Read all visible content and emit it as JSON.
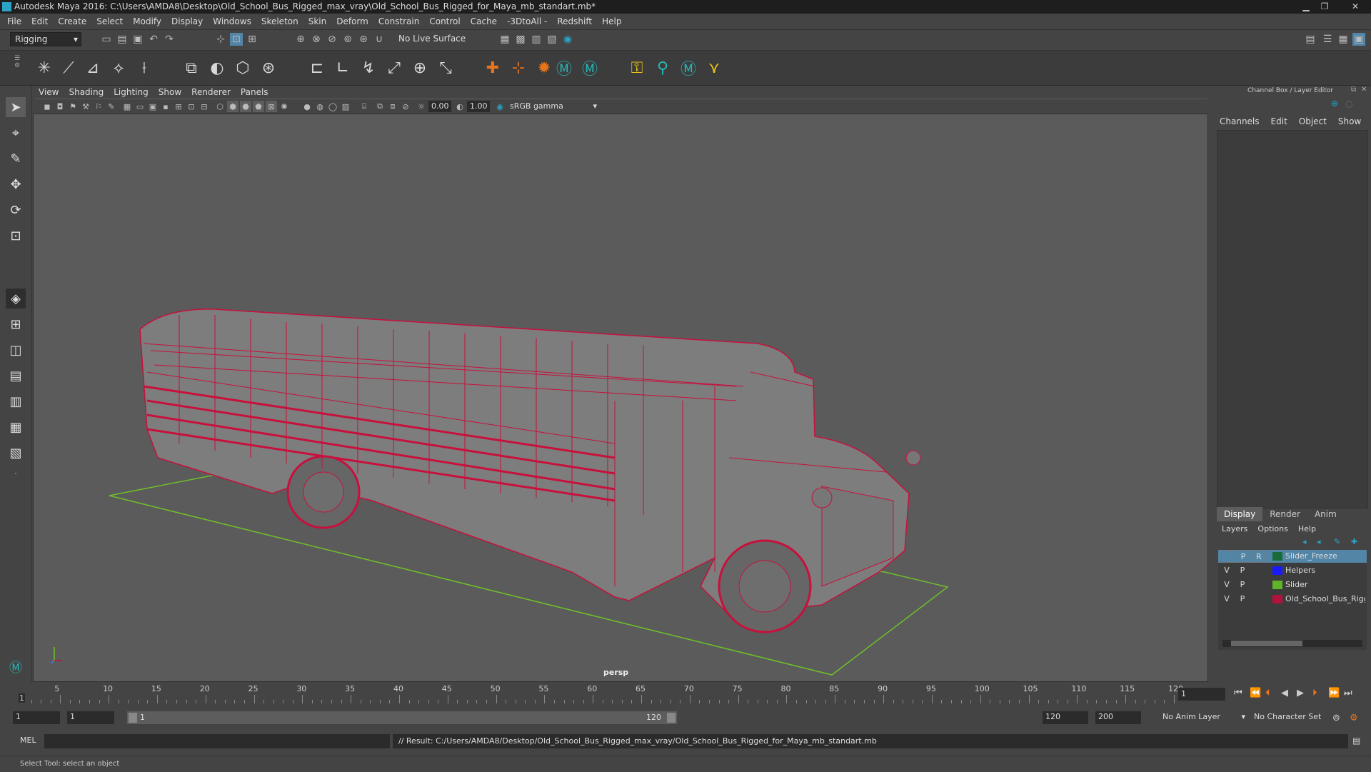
{
  "window": {
    "title": "Autodesk Maya 2016: C:\\Users\\AMDA8\\Desktop\\Old_School_Bus_Rigged_max_vray\\Old_School_Bus_Rigged_for_Maya_mb_standart.mb*",
    "min": "▁",
    "max": "❐",
    "close": "✕"
  },
  "menu": [
    "File",
    "Edit",
    "Create",
    "Select",
    "Modify",
    "Display",
    "Windows",
    "Skeleton",
    "Skin",
    "Deform",
    "Constrain",
    "Control",
    "Cache",
    "-3DtoAll -",
    "Redshift",
    "Help"
  ],
  "statusline": {
    "menuset": "Rigging",
    "live_surface": "No Live Surface"
  },
  "panel": {
    "menu": [
      "View",
      "Shading",
      "Lighting",
      "Show",
      "Renderer",
      "Panels"
    ],
    "near_value": "0.00",
    "far_value": "1.00",
    "color_space": "sRGB gamma",
    "camera_label": "persp"
  },
  "channelbox": {
    "title": "Channel Box / Layer Editor",
    "menu": [
      "Channels",
      "Edit",
      "Object",
      "Show"
    ]
  },
  "layers": {
    "tabs": [
      "Display",
      "Render",
      "Anim"
    ],
    "active_tab": "Display",
    "menu": [
      "Layers",
      "Options",
      "Help"
    ],
    "rows": [
      {
        "v": "",
        "p": "P",
        "r": "R",
        "color": "#1a6b3a",
        "name": "Slider_Freeze",
        "selected": true
      },
      {
        "v": "V",
        "p": "P",
        "r": "",
        "color": "#1a1aff",
        "name": "Helpers",
        "selected": false
      },
      {
        "v": "V",
        "p": "P",
        "r": "",
        "color": "#5fb52a",
        "name": "Slider",
        "selected": false
      },
      {
        "v": "V",
        "p": "P",
        "r": "",
        "color": "#b3123c",
        "name": "Old_School_Bus_Rigged",
        "selected": false
      }
    ]
  },
  "timeline": {
    "labels": [
      "5",
      "10",
      "15",
      "20",
      "25",
      "30",
      "35",
      "40",
      "45",
      "50",
      "55",
      "60",
      "65",
      "70",
      "75",
      "80",
      "85",
      "90",
      "95",
      "100",
      "105",
      "110",
      "115",
      "120"
    ],
    "current_frame_marker": "1",
    "current_frame": "1"
  },
  "range": {
    "start": "1",
    "playback_start": "1",
    "slider_start": "1",
    "slider_end": "120",
    "playback_end": "120",
    "end": "200",
    "anim_layer": "No Anim Layer",
    "char_set": "No Character Set"
  },
  "command": {
    "lang": "MEL",
    "result": "// Result: C:/Users/AMDA8/Desktop/Old_School_Bus_Rigged_max_vray/Old_School_Bus_Rigged_for_Maya_mb_standart.mb"
  },
  "helpline": "Select Tool: select an object",
  "colors": {
    "wire": "#c8103c",
    "grid": "#6fbf2a",
    "viewport_bg": "#5b5b5b",
    "selected_layer": "#5285a6"
  }
}
